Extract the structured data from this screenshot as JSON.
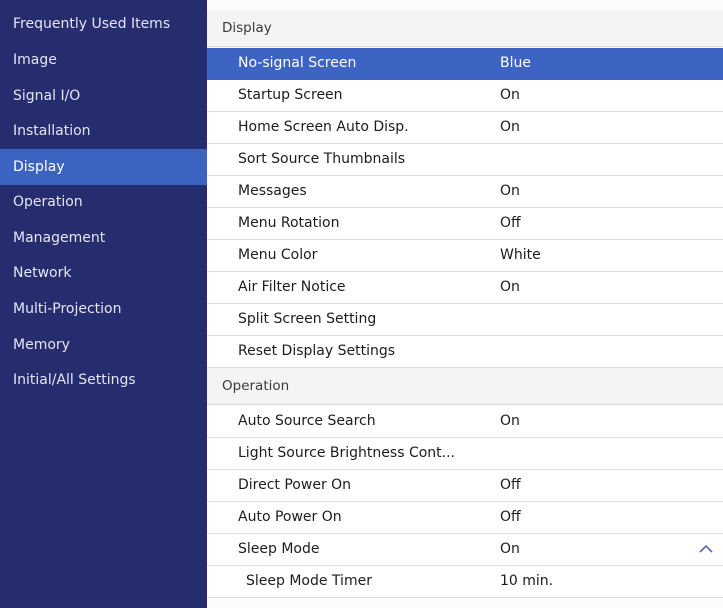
{
  "sidebar": {
    "items": [
      {
        "label": "Frequently Used Items"
      },
      {
        "label": "Image"
      },
      {
        "label": "Signal I/O"
      },
      {
        "label": "Installation"
      },
      {
        "label": "Display"
      },
      {
        "label": "Operation"
      },
      {
        "label": "Management"
      },
      {
        "label": "Network"
      },
      {
        "label": "Multi-Projection"
      },
      {
        "label": "Memory"
      },
      {
        "label": "Initial/All Settings"
      }
    ],
    "active": "Display"
  },
  "main": {
    "sections": [
      {
        "title": "Display",
        "rows": [
          {
            "label": "No-signal Screen",
            "value": "Blue"
          },
          {
            "label": "Startup Screen",
            "value": "On"
          },
          {
            "label": "Home Screen Auto Disp.",
            "value": "On"
          },
          {
            "label": "Sort Source Thumbnails",
            "value": ""
          },
          {
            "label": "Messages",
            "value": "On"
          },
          {
            "label": "Menu Rotation",
            "value": "Off"
          },
          {
            "label": "Menu Color",
            "value": "White"
          },
          {
            "label": "Air Filter Notice",
            "value": "On"
          },
          {
            "label": "Split Screen Setting",
            "value": ""
          },
          {
            "label": "Reset Display Settings",
            "value": ""
          }
        ]
      },
      {
        "title": "Operation",
        "rows": [
          {
            "label": "Auto Source Search",
            "value": "On"
          },
          {
            "label": "Light Source Brightness Cont...",
            "value": ""
          },
          {
            "label": "Direct Power On",
            "value": "Off"
          },
          {
            "label": "Auto Power On",
            "value": "Off"
          },
          {
            "label": "Sleep Mode",
            "value": "On",
            "expanded": true
          },
          {
            "label": "Sleep Mode Timer",
            "value": "10 min."
          }
        ]
      }
    ],
    "selected_row": "No-signal Screen"
  },
  "colors": {
    "sidebar_bg": "#262d6e",
    "selection": "#3c63c1",
    "panel_bg": "#ffffff"
  },
  "icons": {
    "sleep_mode_toggle": "chevron-up-icon"
  }
}
